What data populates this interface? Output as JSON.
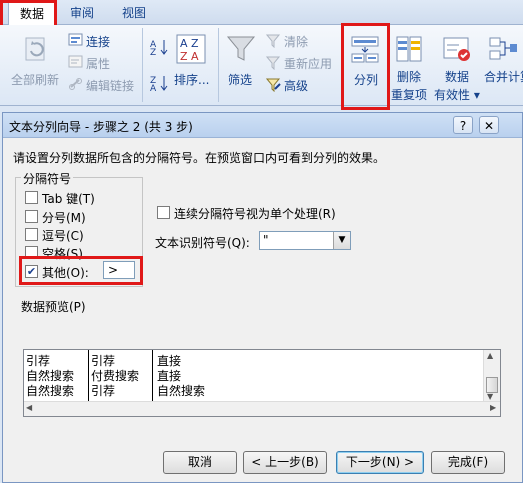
{
  "ribbon": {
    "tabs": [
      "数据",
      "审阅",
      "视图"
    ],
    "group_connections": {
      "refresh_all": "全部刷新",
      "connections": "连接",
      "properties": "属性",
      "edit_links": "编辑链接"
    },
    "group_sort": {
      "sort": "排序..."
    },
    "group_filter": {
      "filter": "筛选",
      "clear": "清除",
      "reapply": "重新应用",
      "advanced": "高级"
    },
    "group_tools": {
      "text_to_columns": "分列",
      "remove_duplicates_1": "删除",
      "remove_duplicates_2": "重复项",
      "validation_1": "数据",
      "validation_2": "有效性 ▾",
      "consolidate": "合并计算"
    }
  },
  "dialog": {
    "title": "文本分列向导 - 步骤之 2 (共 3 步)",
    "help_glyph": "?",
    "close_glyph": "✕",
    "instructions": "请设置分列数据所包含的分隔符号。在预览窗口内可看到分列的效果。",
    "delimiters_group_label": "分隔符号",
    "delimiters": [
      {
        "label": "Tab 键(T)",
        "checked": false
      },
      {
        "label": "分号(M)",
        "checked": false
      },
      {
        "label": "逗号(C)",
        "checked": false
      },
      {
        "label": "空格(S)",
        "checked": false
      },
      {
        "label": "其他(O):",
        "checked": true
      }
    ],
    "other_value": ">",
    "consecutive_label": "连续分隔符号视为单个处理(R)",
    "text_qualifier_label": "文本识别符号(Q):",
    "text_qualifier_value": "\"",
    "preview_label": "数据预览(P)",
    "preview_rows": [
      [
        "引荐",
        "引荐",
        "直接"
      ],
      [
        "自然搜索",
        "付费搜索",
        "直接"
      ],
      [
        "自然搜索",
        "引荐",
        "自然搜索"
      ]
    ],
    "buttons": {
      "cancel": "取消",
      "back": "< 上一步(B)",
      "next": "下一步(N) >",
      "finish": "完成(F)"
    }
  },
  "colors": {
    "highlight": "#e01818",
    "ribbon_text": "#15428b"
  }
}
